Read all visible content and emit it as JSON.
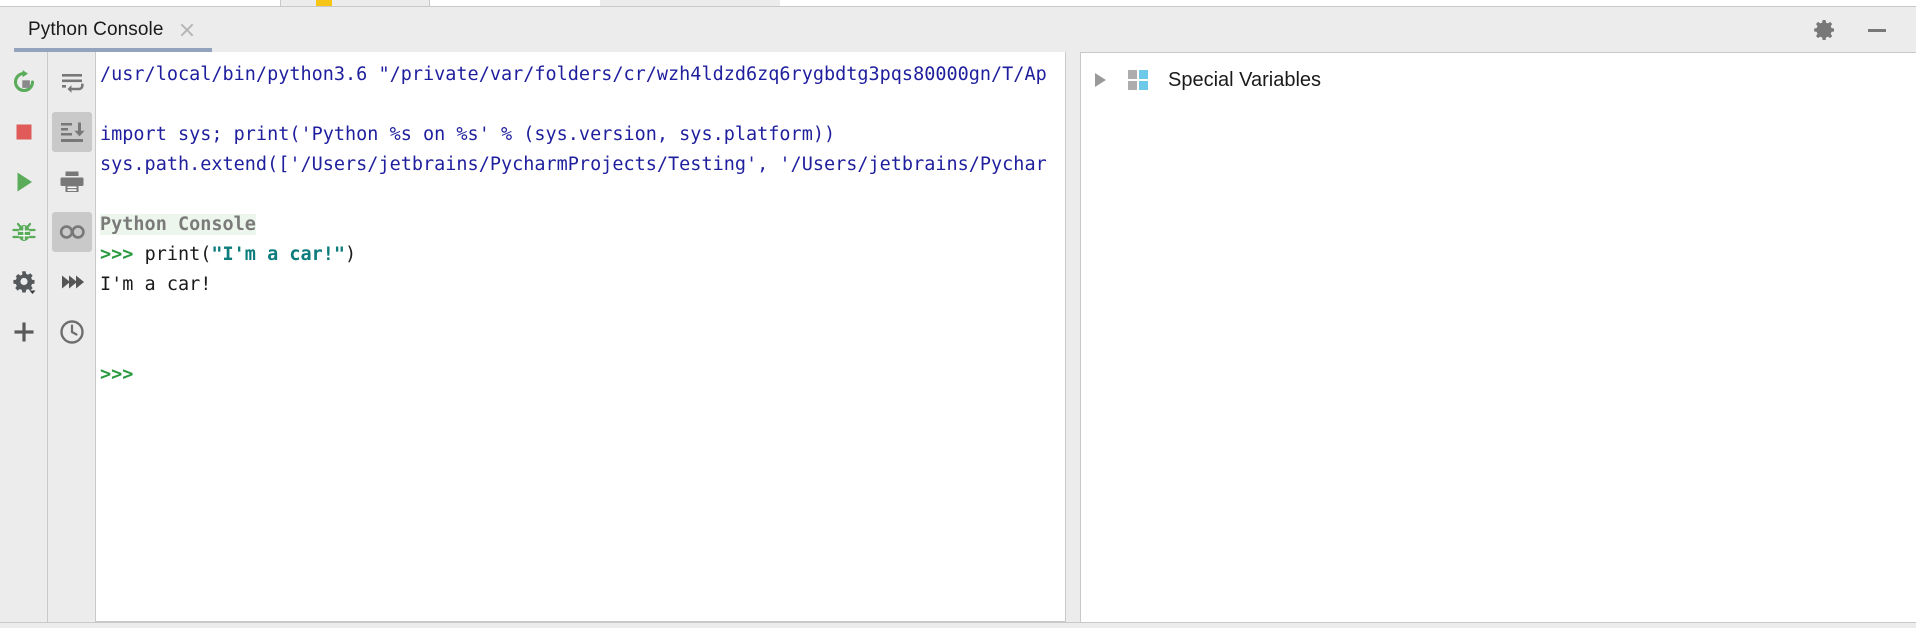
{
  "window": {
    "title": "Python Console",
    "settings_icon": "gear-icon",
    "minimize_icon": "minimize-icon"
  },
  "tab": {
    "label": "Python Console",
    "close_icon": "close-icon"
  },
  "left_toolbar": {
    "items": [
      {
        "name": "rerun-button",
        "icon": "rerun-icon",
        "pressed": false
      },
      {
        "name": "stop-button",
        "icon": "stop-square-icon",
        "pressed": false
      },
      {
        "name": "execute-button",
        "icon": "play-triangle-icon",
        "pressed": false
      },
      {
        "name": "debug-button",
        "icon": "bug-icon",
        "pressed": false
      },
      {
        "name": "settings-button",
        "icon": "gear-dropdown-icon",
        "pressed": false
      },
      {
        "name": "add-console-button",
        "icon": "plus-icon",
        "pressed": false
      }
    ]
  },
  "second_toolbar": {
    "items": [
      {
        "name": "soft-wrap-button",
        "icon": "soft-wrap-icon",
        "pressed": false
      },
      {
        "name": "scroll-to-end-button",
        "icon": "scroll-to-end-icon",
        "pressed": true
      },
      {
        "name": "print-button",
        "icon": "printer-icon",
        "pressed": false
      },
      {
        "name": "show-variables-button",
        "icon": "glasses-icon",
        "pressed": true
      },
      {
        "name": "run-all-button",
        "icon": "double-chevron-icon",
        "pressed": false
      },
      {
        "name": "history-button",
        "icon": "clock-icon",
        "pressed": false
      }
    ]
  },
  "console": {
    "lines": [
      {
        "type": "path",
        "segments": [
          {
            "style": "path",
            "text": "/usr/local/bin/python3.6 \"/private/var/folders/cr/wzh4ldzd6zq6rygbdtg3pqs80000gn/T/Ap"
          }
        ]
      },
      {
        "type": "blank",
        "segments": []
      },
      {
        "type": "code",
        "segments": [
          {
            "style": "code",
            "text": "import sys; print('Python %s on %s' % (sys.version, sys.platform))"
          }
        ]
      },
      {
        "type": "code",
        "segments": [
          {
            "style": "code",
            "text": "sys.path.extend(['/Users/jetbrains/PycharmProjects/Testing', '/Users/jetbrains/Pychar"
          }
        ]
      },
      {
        "type": "blank",
        "segments": []
      },
      {
        "type": "banner",
        "segments": [
          {
            "style": "banner",
            "text": "Python Console"
          }
        ]
      },
      {
        "type": "input",
        "segments": [
          {
            "style": "prompt",
            "text": ">>> "
          },
          {
            "style": "plain",
            "text": "print("
          },
          {
            "style": "string",
            "text": "\"I'm a car!\""
          },
          {
            "style": "plain",
            "text": ")"
          }
        ]
      },
      {
        "type": "output",
        "segments": [
          {
            "style": "plain",
            "text": "I'm a car!"
          }
        ]
      },
      {
        "type": "blank",
        "segments": []
      },
      {
        "type": "blank",
        "segments": []
      },
      {
        "type": "input",
        "segments": [
          {
            "style": "prompt",
            "text": ">>>"
          }
        ]
      }
    ]
  },
  "variables_panel": {
    "expander_icon": "triangle-right-icon",
    "group_icon": "special-variables-grid-icon",
    "label": "Special Variables"
  },
  "colors": {
    "chrome_bg": "#ececec",
    "console_bg": "#ffffff",
    "code_blue": "#1f1f9e",
    "prompt_green": "#2a9a3f",
    "string_teal": "#0c7c7c",
    "banner_gray": "#7a7a7a",
    "banner_bg": "#edf6ed",
    "tab_underline": "#93a2bd",
    "icon_green": "#5aab5a",
    "icon_red": "#e05a5a",
    "icon_gray": "#787878",
    "grid_blue": "#6ec8e8",
    "grid_gray": "#adadad"
  }
}
